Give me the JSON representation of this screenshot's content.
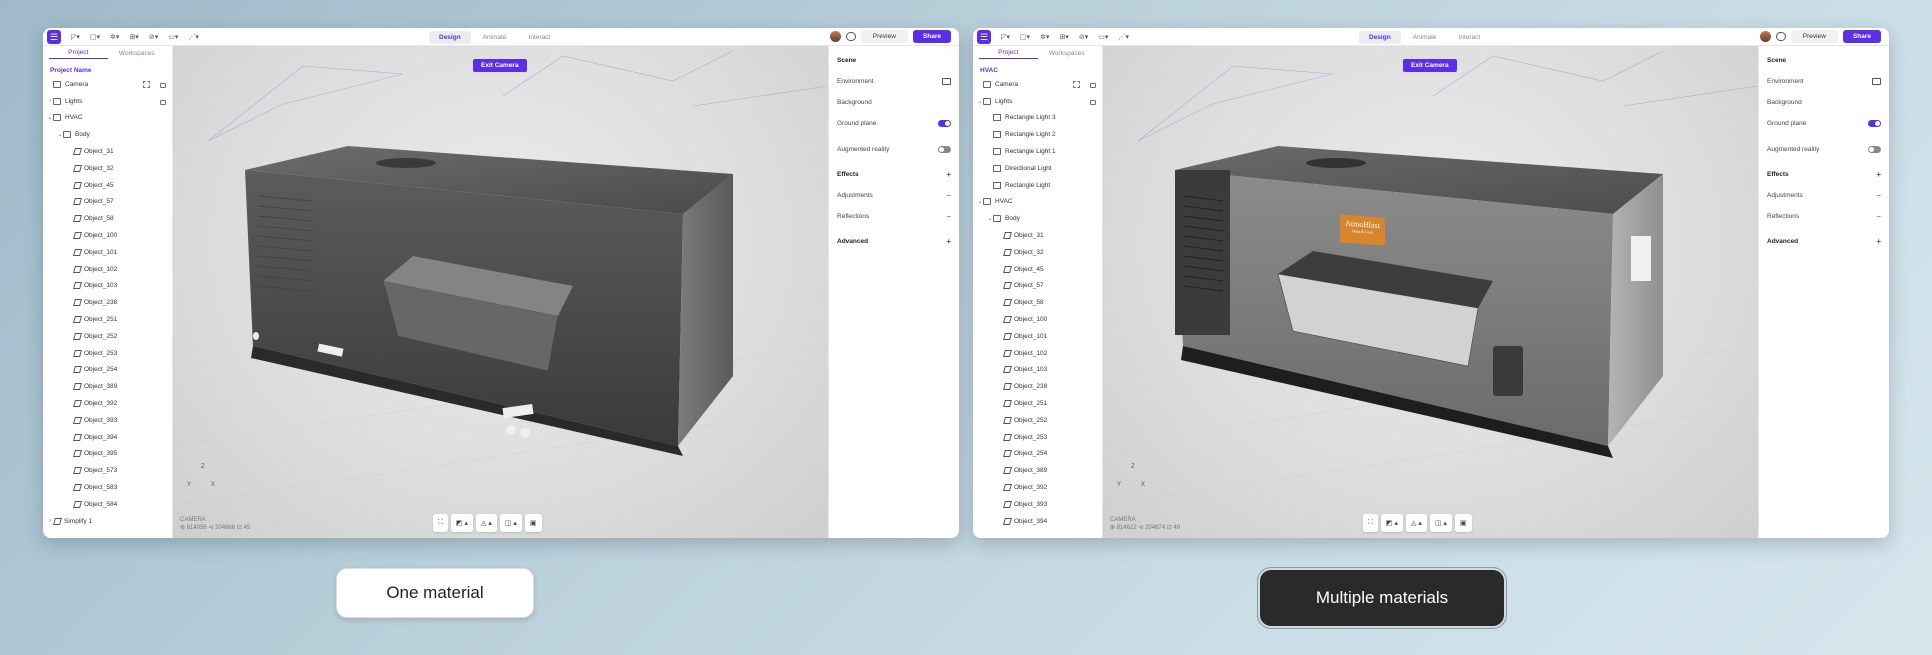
{
  "left_window": {
    "menu_glyph": "☰",
    "toolbar_tools": [
      "◸▾",
      "▢▾",
      "✲▾",
      "⊞▾",
      "⊘▾",
      "▭▾",
      "⋰▾"
    ],
    "mode_tabs": [
      "Design",
      "Animate",
      "Interact"
    ],
    "preview_label": "Preview",
    "share_label": "Share",
    "panel_tabs": [
      "Project",
      "Workspaces"
    ],
    "project_name": "Project Name",
    "tree": [
      {
        "label": "Camera",
        "kind": "camera",
        "depth": 0
      },
      {
        "label": "Lights",
        "kind": "folder",
        "depth": 0,
        "chev": "›"
      },
      {
        "label": "HVAC",
        "kind": "folder",
        "depth": 0,
        "chev": "⌄"
      },
      {
        "label": "Body",
        "kind": "folder",
        "depth": 1,
        "chev": "⌄"
      },
      {
        "label": "Object_31",
        "kind": "object",
        "depth": 2
      },
      {
        "label": "Object_32",
        "kind": "object",
        "depth": 2
      },
      {
        "label": "Object_45",
        "kind": "object",
        "depth": 2
      },
      {
        "label": "Object_57",
        "kind": "object",
        "depth": 2
      },
      {
        "label": "Object_58",
        "kind": "object",
        "depth": 2
      },
      {
        "label": "Object_100",
        "kind": "object",
        "depth": 2
      },
      {
        "label": "Object_101",
        "kind": "object",
        "depth": 2
      },
      {
        "label": "Object_102",
        "kind": "object",
        "depth": 2
      },
      {
        "label": "Object_103",
        "kind": "object",
        "depth": 2
      },
      {
        "label": "Object_238",
        "kind": "object",
        "depth": 2
      },
      {
        "label": "Object_251",
        "kind": "object",
        "depth": 2
      },
      {
        "label": "Object_252",
        "kind": "object",
        "depth": 2
      },
      {
        "label": "Object_253",
        "kind": "object",
        "depth": 2
      },
      {
        "label": "Object_254",
        "kind": "object",
        "depth": 2
      },
      {
        "label": "Object_389",
        "kind": "object",
        "depth": 2
      },
      {
        "label": "Object_392",
        "kind": "object",
        "depth": 2
      },
      {
        "label": "Object_393",
        "kind": "object",
        "depth": 2
      },
      {
        "label": "Object_394",
        "kind": "object",
        "depth": 2
      },
      {
        "label": "Object_395",
        "kind": "object",
        "depth": 2
      },
      {
        "label": "Object_573",
        "kind": "object",
        "depth": 2
      },
      {
        "label": "Object_583",
        "kind": "object",
        "depth": 2
      },
      {
        "label": "Object_584",
        "kind": "object",
        "depth": 2
      },
      {
        "label": "Simplify 1",
        "kind": "object",
        "depth": 0,
        "chev": "›"
      }
    ],
    "exit_camera": "Exit Camera",
    "axis_z": "Z",
    "axis_y": "Y",
    "axis_x": "X",
    "camera_label": "CAMERA",
    "camera_stats": "⊕ 814056   ⊲ 204666   ⊡ 45",
    "vp_tools": [
      "⛶",
      "◩ ▴",
      "◬ ▴",
      "◫ ▴",
      "▣"
    ],
    "scene": {
      "title": "Scene",
      "environment": "Environment",
      "background": "Background",
      "ground_plane": "Ground plane",
      "augmented_reality": "Augmented reality",
      "effects": "Effects",
      "adjustments": "Adjustments",
      "reflections": "Reflections",
      "advanced": "Advanced",
      "plus": "+",
      "minus": "−"
    },
    "ground_plane_on": true,
    "augmented_reality_on": false
  },
  "right_window": {
    "project_name": "HVAC",
    "tree": [
      {
        "label": "Camera",
        "kind": "camera",
        "depth": 0
      },
      {
        "label": "Lights",
        "kind": "folder",
        "depth": 0,
        "chev": "⌄"
      },
      {
        "label": "Rectangle Light 3",
        "kind": "light",
        "depth": 1
      },
      {
        "label": "Rectangle Light 2",
        "kind": "light",
        "depth": 1
      },
      {
        "label": "Rectangle Light 1",
        "kind": "light",
        "depth": 1
      },
      {
        "label": "Directional Light",
        "kind": "light",
        "depth": 1
      },
      {
        "label": "Rectangle Light",
        "kind": "light",
        "depth": 1
      },
      {
        "label": "HVAC",
        "kind": "folder",
        "depth": 0,
        "chev": "⌄"
      },
      {
        "label": "Body",
        "kind": "folder",
        "depth": 1,
        "chev": "⌄"
      },
      {
        "label": "Object_31",
        "kind": "object",
        "depth": 2
      },
      {
        "label": "Object_32",
        "kind": "object",
        "depth": 2
      },
      {
        "label": "Object_45",
        "kind": "object",
        "depth": 2
      },
      {
        "label": "Object_57",
        "kind": "object",
        "depth": 2
      },
      {
        "label": "Object_58",
        "kind": "object",
        "depth": 2
      },
      {
        "label": "Object_100",
        "kind": "object",
        "depth": 2
      },
      {
        "label": "Object_101",
        "kind": "object",
        "depth": 2
      },
      {
        "label": "Object_102",
        "kind": "object",
        "depth": 2
      },
      {
        "label": "Object_103",
        "kind": "object",
        "depth": 2
      },
      {
        "label": "Object_238",
        "kind": "object",
        "depth": 2
      },
      {
        "label": "Object_251",
        "kind": "object",
        "depth": 2
      },
      {
        "label": "Object_252",
        "kind": "object",
        "depth": 2
      },
      {
        "label": "Object_253",
        "kind": "object",
        "depth": 2
      },
      {
        "label": "Object_254",
        "kind": "object",
        "depth": 2
      },
      {
        "label": "Object_389",
        "kind": "object",
        "depth": 2
      },
      {
        "label": "Object_392",
        "kind": "object",
        "depth": 2
      },
      {
        "label": "Object_393",
        "kind": "object",
        "depth": 2
      },
      {
        "label": "Object_394",
        "kind": "object",
        "depth": 2
      }
    ],
    "camera_stats": "⊕ 814622   ⊲ 204874   ⊡ 49",
    "brand_label": "AtmoBlast",
    "brand_sub": "Heat & Cool"
  },
  "captions": {
    "left": "One material",
    "right": "Multiple materials"
  },
  "colors": {
    "accent": "#5b2ee8",
    "caption_dark": "#2a2a2a",
    "brand_label_bg": "#d9852e"
  }
}
